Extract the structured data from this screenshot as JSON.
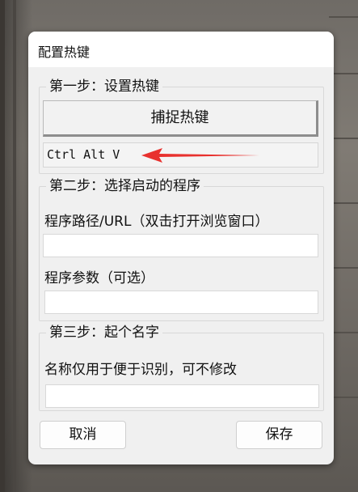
{
  "dialog": {
    "title": "配置热键"
  },
  "step1": {
    "legend": "第一步：设置热键",
    "capture_button_label": "捕捉热键",
    "hotkey_value": "Ctrl Alt V"
  },
  "step2": {
    "legend": "第二步：选择启动的程序",
    "path_label": "程序路径/URL（双击打开浏览窗口）",
    "path_value": "",
    "args_label": "程序参数（可选）",
    "args_value": ""
  },
  "step3": {
    "legend": "第三步：起个名字",
    "name_label": "名称仅用于便于识别，可不修改",
    "name_value": ""
  },
  "footer": {
    "cancel_label": "取消",
    "save_label": "保存"
  },
  "colors": {
    "annotation_arrow": "#e8312e",
    "dialog_background": "#f0f0f0",
    "titlebar_background": "#ffffff"
  },
  "icons": {
    "annotation": "red-arrow-icon"
  }
}
